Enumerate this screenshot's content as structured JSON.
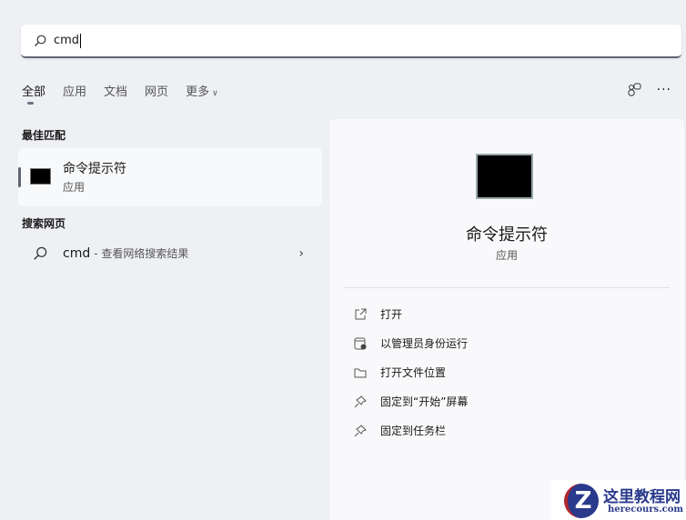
{
  "search": {
    "value": "cmd"
  },
  "tabs": [
    "全部",
    "应用",
    "文档",
    "网页",
    "更多"
  ],
  "best_match": {
    "heading": "最佳匹配",
    "name": "命令提示符",
    "type": "应用"
  },
  "web": {
    "heading": "搜索网页",
    "query": "cmd",
    "suffix": "- 查看网络搜索结果"
  },
  "detail": {
    "name": "命令提示符",
    "type": "应用",
    "actions": [
      "打开",
      "以管理员身份运行",
      "打开文件位置",
      "固定到“开始”屏幕",
      "固定到任务栏"
    ]
  },
  "watermark": {
    "name": "这里教程网",
    "url": "herecours.com",
    "letter": "Z"
  }
}
